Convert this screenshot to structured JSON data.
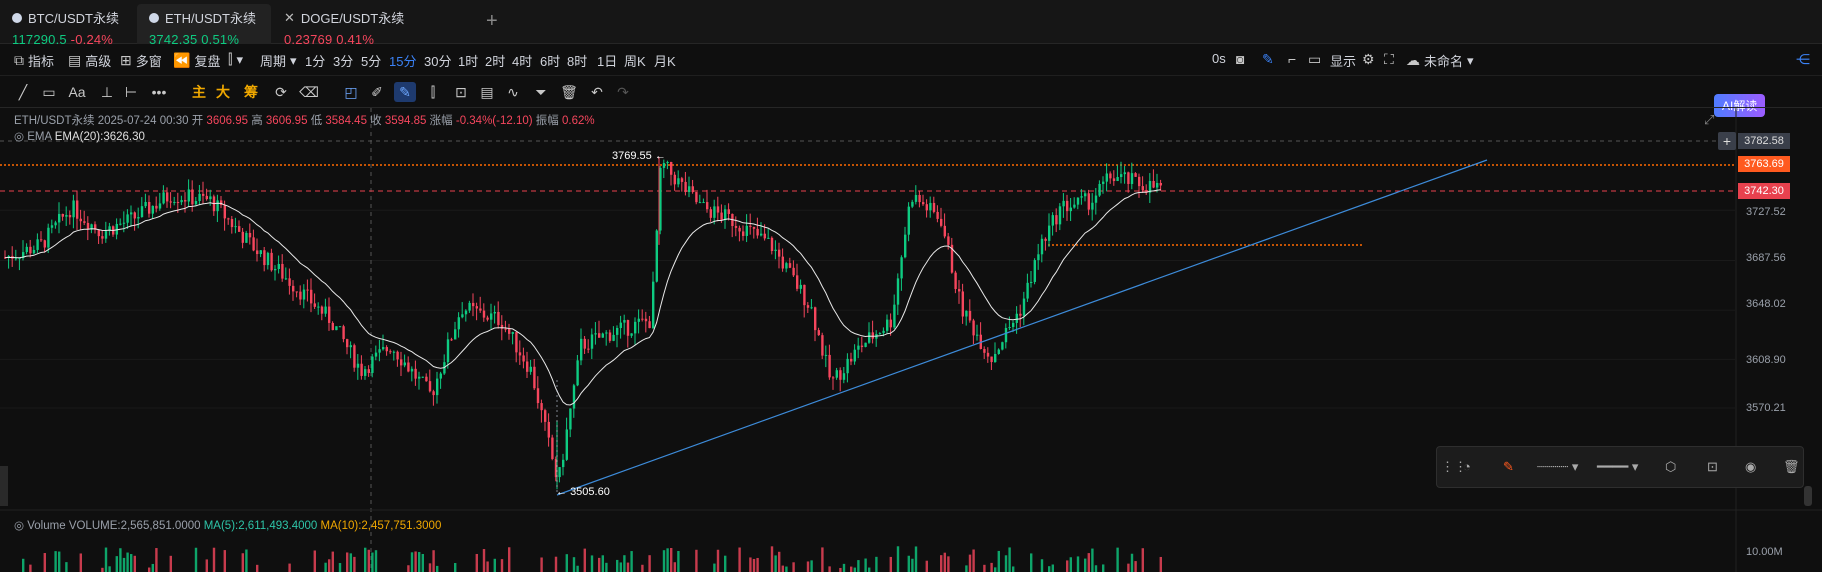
{
  "tabs": [
    {
      "name": "BTC/USDT永续",
      "price": "117290.5",
      "change": "-0.24%",
      "dir": "up",
      "chg_dir": "down"
    },
    {
      "name": "ETH/USDT永续",
      "price": "3742.35",
      "change": "0.51%",
      "dir": "up",
      "chg_dir": "up"
    },
    {
      "name": "DOGE/USDT永续",
      "price": "0.23769",
      "change": "0.41%",
      "dir": "down",
      "chg_dir": "down"
    }
  ],
  "toolbar": {
    "indicators": "指标",
    "advanced": "高级",
    "multiwin": "多窗",
    "replay": "复盘",
    "period": "周期",
    "intervals": [
      "1分",
      "3分",
      "5分",
      "15分",
      "30分",
      "1时",
      "2时",
      "4时",
      "6时",
      "8时",
      "1日",
      "周K",
      "月K"
    ],
    "selected_interval": "15分",
    "countdown": "0s",
    "display": "显示",
    "unnamed": "未命名",
    "ai": "AI解读"
  },
  "drawbar": {
    "zhu": "主",
    "da": "大",
    "chou": "筹"
  },
  "ohlc": {
    "symbol": "ETH/USDT永续",
    "datetime": "2025-07-24 00:30",
    "open_label": "开",
    "open": "3606.95",
    "high_label": "高",
    "high": "3606.95",
    "low_label": "低",
    "low": "3584.45",
    "close_label": "收",
    "close": "3594.85",
    "chg_label": "涨幅",
    "chg": "-0.34%(-12.10)",
    "amp_label": "振幅",
    "amp": "0.62%"
  },
  "ema": {
    "label": "EMA",
    "value": "EMA(20):3626.30"
  },
  "volume": {
    "label": "Volume",
    "value": "VOLUME:2,565,851.0000",
    "ma5": "MA(5):2,611,493.4000",
    "ma10": "MA(10):2,457,751.3000",
    "axis": "10.00M"
  },
  "yaxis": [
    "3782.58",
    "3727.52",
    "3687.56",
    "3648.02",
    "3608.90",
    "3570.21"
  ],
  "price_tags": {
    "resistance": "3763.69",
    "current": "3742.30"
  },
  "annotations": {
    "high": "3769.55",
    "low": "3505.60"
  },
  "colors": {
    "up": "#0ecb81",
    "down": "#f6465d",
    "accent": "#3b82f6",
    "orange": "#ff6a00",
    "trend": "#3d8bd9"
  }
}
